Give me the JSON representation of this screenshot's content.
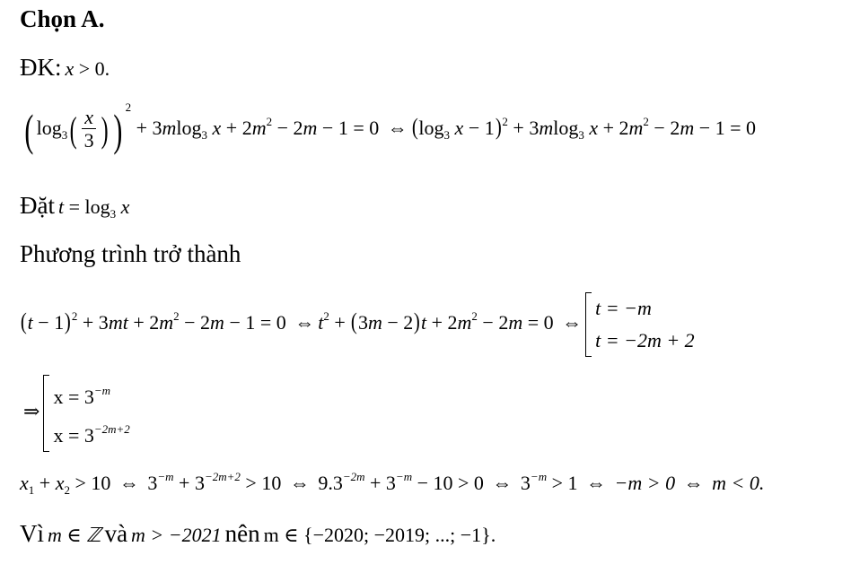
{
  "heading": "Chọn A.",
  "condition": {
    "label": "ĐK:",
    "expr_var": "x",
    "expr_rest": " > 0."
  },
  "eq1": {
    "log": "log",
    "base": "3",
    "frac_num": "x",
    "frac_den": "3",
    "power": "2",
    "rest_a": " + 3",
    "m": "m",
    "log2": "log",
    "base2": "3",
    "x": "x",
    "rest_b": " + 2",
    "m2": "m",
    "sq": "2",
    "rest_c": " − 2",
    "m3": "m",
    "rest_d": " − 1 = 0 ",
    "iff": "⇔",
    "r_log": "log",
    "r_base": "3",
    "r_x": "x",
    "r_minus1": " − 1",
    "r_pow": "2",
    "r_rest_a": " + 3",
    "r_m": "m",
    "r_log2": "log",
    "r_base2": "3",
    "r_x2": "x",
    "r_rest_b": " + 2",
    "r_m2": "m",
    "r_sq": "2",
    "r_rest_c": " − 2",
    "r_m3": "m",
    "r_rest_d": " − 1 = 0"
  },
  "substitution": {
    "label": "Đặt",
    "t": "t",
    "eq": " = log",
    "base": "3",
    "x": "x"
  },
  "transform_text": "Phương trình trở thành",
  "eq2": {
    "t": "t",
    "minus1": " − 1",
    "pow": "2",
    "a": " + 3",
    "mt": "mt",
    "b": " + 2",
    "m": "m",
    "sq": "2",
    "c": " − 2",
    "m2": "m",
    "d": " − 1 = 0 ",
    "iff": "⇔",
    "t2": "t",
    "t2pow": "2",
    "e": " + ",
    "inner": "3",
    "inner_m": "m",
    "inner_rest": " − 2",
    "t3": "t",
    "f": " + 2",
    "m3": "m",
    "sq2": "2",
    "g": " − 2",
    "m4": "m",
    "h": " = 0 ",
    "iff2": "⇔",
    "case1": "t = −m",
    "case2": "t = −2m + 2"
  },
  "eq3": {
    "arrow": "⇒",
    "case1_lhs": "x = 3",
    "case1_exp": "−m",
    "case2_lhs": "x = 3",
    "case2_exp": "−2m+2"
  },
  "eq4": {
    "x1": "x",
    "s1": "1",
    "plus": " + ",
    "x2": "x",
    "s2": "2",
    "gt": " > 10 ",
    "iff": "⇔",
    "p1": " 3",
    "e1": "−m",
    "p2": " + 3",
    "e2": "−2m+2",
    "gt2": " > 10 ",
    "iff2": "⇔",
    "p3": " 9.3",
    "e3": "−2m",
    "p4": " + 3",
    "e4": "−m",
    "p5": " − 10 > 0 ",
    "iff3": "⇔",
    "p6": " 3",
    "e6": "−m",
    "p7": " > 1 ",
    "iff4": "⇔",
    "p8": " −m > 0 ",
    "iff5": "⇔",
    "p9": " m < 0."
  },
  "conclusion": {
    "because": "Vì",
    "m_in_Z": "m ∈ ℤ",
    "and": "và",
    "m_gt": "m > −2021",
    "so": "nên",
    "m_set": "m ∈ {−2020; −2019; ...; −1}."
  }
}
